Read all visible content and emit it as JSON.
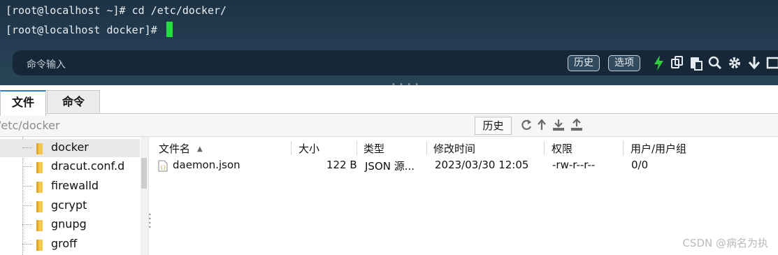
{
  "terminal": {
    "line1": "[root@localhost ~]# cd /etc/docker/",
    "line2": "[root@localhost docker]# ",
    "cmd_placeholder": "命令输入",
    "history_btn": "历史",
    "options_btn": "选项",
    "icons": [
      "lightning-icon",
      "copy-icon",
      "paste-icon",
      "search-icon",
      "gear-icon",
      "download-icon",
      "window-icon"
    ]
  },
  "tabs": [
    {
      "label": "文件",
      "active": true
    },
    {
      "label": "命令",
      "active": false
    }
  ],
  "pathbar": {
    "path": "/etc/docker",
    "history_btn": "历史",
    "icons": [
      "refresh-icon",
      "up-icon",
      "download-icon",
      "upload-icon"
    ]
  },
  "tree": {
    "items": [
      {
        "label": "docker",
        "selected": true
      },
      {
        "label": "dracut.conf.d",
        "selected": false
      },
      {
        "label": "firewalld",
        "selected": false
      },
      {
        "label": "gcrypt",
        "selected": false
      },
      {
        "label": "gnupg",
        "selected": false
      },
      {
        "label": "groff",
        "selected": false
      }
    ]
  },
  "filelist": {
    "columns": [
      "文件名",
      "大小",
      "类型",
      "修改时间",
      "权限",
      "用户/用户组"
    ],
    "sort_column": "文件名",
    "rows": [
      {
        "name": "daemon.json",
        "size": "122 B",
        "type": "JSON 源...",
        "modified": "2023/03/30 12:05",
        "perms": "-rw-r--r--",
        "owner": "0/0"
      }
    ]
  },
  "watermark": "CSDN @病名为执",
  "colors": {
    "cursor": "#22e03a",
    "lightning": "#2ecc40",
    "tab_accent": "#2f7cd3",
    "terminal_bg": "#1d3345"
  }
}
